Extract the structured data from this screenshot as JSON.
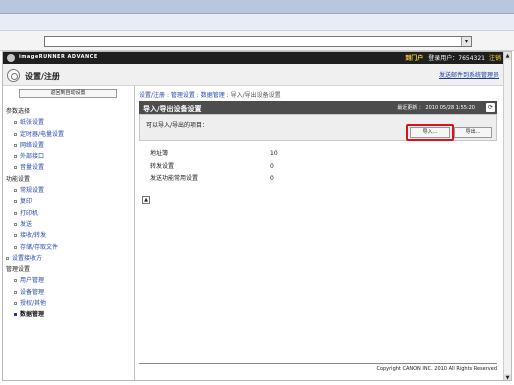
{
  "browser": {
    "address_dropdown_icon": "▾"
  },
  "brand": {
    "logo_icon": "gear-logo",
    "product_name": "imageRUNNER ADVANCE",
    "portal_label": "到门户",
    "login_user_label": "登录用户：",
    "login_user_value": "7654321",
    "logout_label": "注销"
  },
  "header": {
    "icon": "settings-gear-icon",
    "title": "设置/注册",
    "admin_link": "发送邮件到系统管理员"
  },
  "sidebar": {
    "back_button": "返回到自动设置",
    "items": [
      {
        "type": "head",
        "label": "参数选择"
      },
      {
        "type": "child",
        "label": "纸张设置"
      },
      {
        "type": "child",
        "label": "定时器/电量设置"
      },
      {
        "type": "child",
        "label": "网络设置"
      },
      {
        "type": "child",
        "label": "外部接口"
      },
      {
        "type": "child",
        "label": "音量设置"
      },
      {
        "type": "head",
        "label": "功能设置"
      },
      {
        "type": "child",
        "label": "常规设置"
      },
      {
        "type": "child",
        "label": "复印"
      },
      {
        "type": "child",
        "label": "打印机"
      },
      {
        "type": "child",
        "label": "发送"
      },
      {
        "type": "child",
        "label": "接收/转发"
      },
      {
        "type": "child",
        "label": "存储/存取文件"
      },
      {
        "type": "top",
        "label": "设置接收方"
      },
      {
        "type": "head",
        "label": "管理设置"
      },
      {
        "type": "child",
        "label": "用户管理"
      },
      {
        "type": "child",
        "label": "设备管理"
      },
      {
        "type": "child",
        "label": "授权/其他"
      },
      {
        "type": "child",
        "label": "数据管理",
        "active": true
      }
    ]
  },
  "main": {
    "breadcrumb": [
      "设置/注册",
      "管理设置",
      "数据管理",
      "导入/导出设备设置"
    ],
    "breadcrumb_sep": " : ",
    "section_title": "导入/导出设备设置",
    "last_updated": "最近更新 ： 2010 05/28 1:55:20",
    "refresh_icon": "refresh-icon",
    "info_text": "可以导入/导出的项目：",
    "import_button": "导入...",
    "export_button": "导出...",
    "rows": [
      {
        "label": "地址簿",
        "value": "10"
      },
      {
        "label": "转发设置",
        "value": "0"
      },
      {
        "label": "发送功能常用设置",
        "value": "0"
      }
    ],
    "top_icon": "page-top-icon",
    "footer": "Copyright CANON INC. 2010 All Rights Reserved"
  },
  "colors": {
    "brand_bar": "#1f1f1f",
    "section_bar": "#4d4d4d",
    "link": "#2849b0",
    "highlight": "#d7141a"
  }
}
